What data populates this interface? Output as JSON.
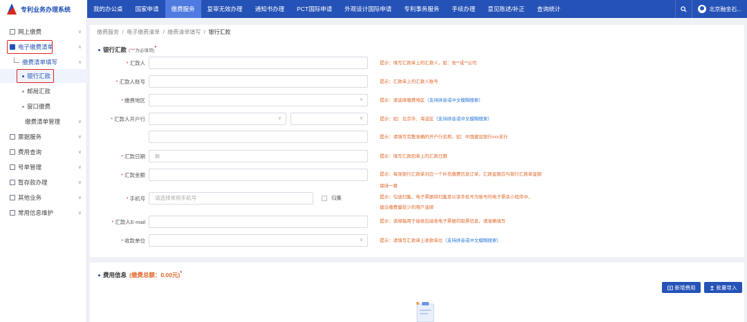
{
  "app": {
    "title": "专利业务办理系统"
  },
  "nav": {
    "items": [
      "我的办公桌",
      "国家申请",
      "缴费服务",
      "复审无效办理",
      "通知书办理",
      "PCT国际申请",
      "外观设计国际申请",
      "专利事务服务",
      "手续办理",
      "意见陈述/补正",
      "查询统计"
    ],
    "active_index": 2
  },
  "user": {
    "name": "北京融金石..."
  },
  "sidebar": {
    "items": [
      {
        "label": "网上缴费",
        "chev": "∨"
      },
      {
        "label": "电子缴费清单",
        "chev": "∧"
      },
      {
        "label": "缴费清单填写",
        "chev": "∧"
      },
      {
        "label": "银行汇款"
      },
      {
        "label": "邮局汇款"
      },
      {
        "label": "窗口缴费"
      },
      {
        "label": "缴费清单管理",
        "chev": "∨"
      },
      {
        "label": "票据服务",
        "chev": "∨"
      },
      {
        "label": "费用查询",
        "chev": "∨"
      },
      {
        "label": "号单管理",
        "chev": "∨"
      },
      {
        "label": "暂存款办理",
        "chev": "∨"
      },
      {
        "label": "其他业务",
        "chev": "∨"
      },
      {
        "label": "常用信息维护",
        "chev": "∨"
      }
    ]
  },
  "breadcrumb": [
    "缴费服务",
    "电子缴费清单",
    "缴费清单填写",
    "银行汇款"
  ],
  "breadcrumb_sep": "/",
  "bank_section": {
    "title": "银行汇款",
    "note_prefix": "(",
    "note_star": "\"*\"",
    "note_suffix": "为必填项)",
    "title_star": "*"
  },
  "form": {
    "remitter": {
      "label": "汇款人",
      "tip": "提示：填写汇款单上的汇款人，如：张**或**公司"
    },
    "remitter_account": {
      "label": "汇款人账号",
      "tip": "提示：汇款单上的汇款人账号"
    },
    "region": {
      "label": "缴费地区",
      "tip": "提示：请选择缴费地区",
      "tip_blue": "（支持拼音或中文模糊搜索）"
    },
    "bank": {
      "label": "汇款人开户行",
      "tip": "提示：如：北京市、海淀区",
      "tip_blue": "（支持拼音或中文模糊搜索）"
    },
    "bank_detail": {
      "tip": "提示：请填写完整准确的开户行名称，如：中国建设银行xxx支行"
    },
    "date": {
      "label": "汇款日期",
      "tip": "提示：填写汇款回单上的汇款日期"
    },
    "amount": {
      "label": "汇款金额",
      "tip1": "提示：每张银行汇款单对应一个补充缴费信息订单，汇款金额应与银行汇款单金额",
      "tip2": "保持一致"
    },
    "phone": {
      "label": "手机号",
      "placeholder": "请选择常用手机号",
      "checkbox": "归集",
      "tip1": "提示：勾选归集，电子票据将归集至以该手机号为账号的电子票夹小程序中，",
      "tip2": "建议缴费量较少的用户选择"
    },
    "email": {
      "label": "汇款人E-mail",
      "tip": "提示：该邮箱用于接收后接收电子票据的取票信息，请准确填写"
    },
    "payee": {
      "label": "收款单位",
      "tip": "提示：请填写汇款单上收款单位",
      "tip_blue": "（支持拼音或中文模糊搜索）"
    }
  },
  "fee_section": {
    "title": "费用信息",
    "total_label": "(缴费总额：0.00元)",
    "title_star": "*"
  },
  "buttons": {
    "add_fee": "新增费用",
    "batch_import": "批量导入"
  },
  "icons": {
    "dropdown": "∨",
    "calendar": "▦",
    "search": "search-icon",
    "user": "user-icon"
  },
  "colors": {
    "primary": "#2552b7",
    "tip": "#e0682a",
    "link": "#2a7ad8",
    "highlight": "#e02020"
  }
}
